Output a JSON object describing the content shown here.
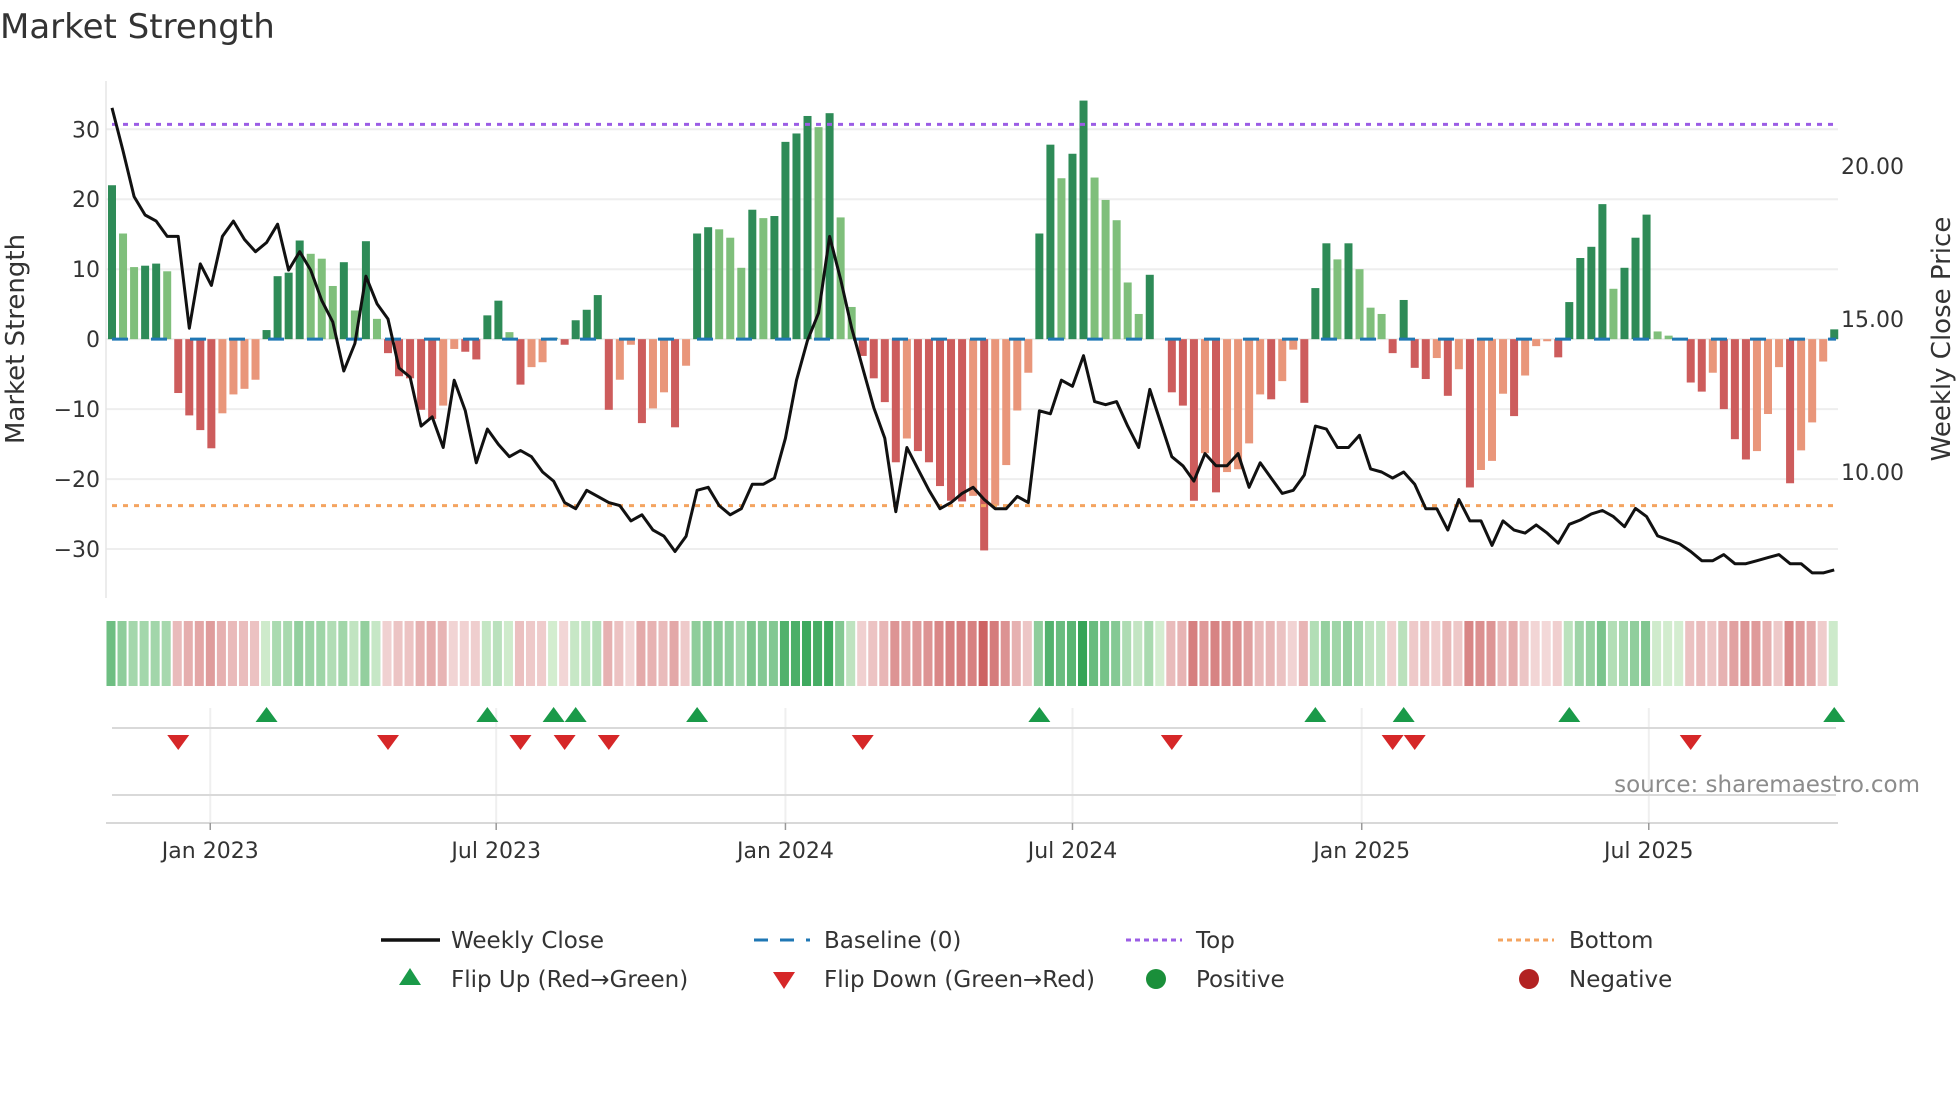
{
  "chart_data": {
    "type": "bar",
    "title": "Market Strength",
    "ylabel": "Market Strength",
    "ylabel_right": "Weekly Close Price",
    "ylim": [
      -37,
      36.9
    ],
    "ylim_right": [
      5.88,
      22.78
    ],
    "grid": true,
    "y_ticks": [
      -30,
      -20,
      -10,
      0,
      10,
      20,
      30
    ],
    "y_tick_labels": [
      "−30",
      "−20",
      "−10",
      "0",
      "10",
      "20",
      "30"
    ],
    "y_right_ticks": [
      10,
      15,
      20
    ],
    "y_right_tick_labels": [
      "10.00",
      "15.00",
      "20.00"
    ],
    "x_ticks": [
      8.9,
      34.8,
      61.0,
      87.0,
      113.2,
      139.2
    ],
    "x_tick_labels": [
      "Jan 2023",
      "Jul 2023",
      "Jan 2024",
      "Jul 2024",
      "Jan 2025",
      "Jul 2025"
    ],
    "top_level": 30.7,
    "bottom_level": -23.8,
    "baseline": 0,
    "strength": [
      22.0,
      15.1,
      10.3,
      10.5,
      10.8,
      9.7,
      -7.7,
      -10.9,
      -13.0,
      -15.6,
      -10.6,
      -7.9,
      -7.1,
      -5.8,
      1.3,
      9.0,
      9.5,
      14.1,
      12.2,
      11.5,
      7.6,
      11.0,
      4.1,
      14.0,
      2.9,
      -2.0,
      -5.3,
      -5.6,
      -10.1,
      -11.4,
      -9.5,
      -1.4,
      -1.8,
      -2.9,
      3.4,
      5.5,
      1.0,
      -6.5,
      -4.0,
      -3.3,
      0.2,
      -0.8,
      2.7,
      4.2,
      6.3,
      -10.1,
      -5.8,
      -0.8,
      -12.0,
      -9.9,
      -7.6,
      -12.6,
      -3.8,
      15.1,
      16.0,
      15.7,
      14.5,
      10.2,
      18.5,
      17.3,
      17.6,
      28.2,
      29.4,
      31.9,
      30.3,
      32.3,
      17.4,
      4.6,
      -2.4,
      -5.6,
      -9.0,
      -17.6,
      -14.2,
      -16.0,
      -17.6,
      -21.0,
      -23.1,
      -23.2,
      -22.4,
      -30.2,
      -23.8,
      -18.0,
      -10.2,
      -4.8,
      15.1,
      27.8,
      23.0,
      26.5,
      34.1,
      23.1,
      19.9,
      17.0,
      8.1,
      3.6,
      9.2,
      0,
      -7.6,
      -9.5,
      -23.1,
      -16.3,
      -21.9,
      -19.0,
      -18.6,
      -14.9,
      -7.9,
      -8.6,
      -6.0,
      -1.5,
      -9.1,
      7.3,
      13.7,
      11.4,
      13.7,
      10.0,
      4.5,
      3.6,
      -2.0,
      5.6,
      -4.1,
      -5.7,
      -2.7,
      -8.1,
      -4.3,
      -21.2,
      -18.7,
      -17.4,
      -7.8,
      -11.0,
      -5.2,
      -1.0,
      -0.3,
      -2.6,
      5.3,
      11.6,
      13.2,
      19.3,
      7.2,
      10.2,
      14.5,
      17.8,
      1.1,
      0.5,
      0,
      -6.2,
      -7.5,
      -4.8,
      -10.0,
      -14.3,
      -17.2,
      -16.0,
      -10.7,
      -4.0,
      -20.6,
      -15.9,
      -11.9,
      -3.2,
      1.4
    ],
    "strength_shade": "DLLDDLDDDDLLLLDDDDLLLDLDLDDDDDLLDDDDLDLLDDDDDDLLDLLDLDDLLLDLDDDDLDLLDDDDLDDDDDLDLLLLDDLDDLLLLLDDDDDLDLLLLDLLDDDLDLLLDDDDLDLDLLLDLLLDDDDDLDDDLLDDDLDDDLLLDLLLD",
    "weekly_close": [
      21.9,
      20.5,
      19.0,
      18.4,
      18.2,
      17.7,
      17.7,
      14.7,
      16.8,
      16.1,
      17.7,
      18.2,
      17.6,
      17.2,
      17.5,
      18.1,
      16.6,
      17.2,
      16.6,
      15.6,
      14.9,
      13.3,
      14.2,
      16.4,
      15.5,
      15.0,
      13.4,
      13.1,
      11.5,
      11.8,
      10.8,
      13.0,
      12.0,
      10.3,
      11.4,
      10.9,
      10.5,
      10.7,
      10.5,
      10.0,
      9.7,
      9.0,
      8.8,
      9.4,
      9.2,
      9.0,
      8.9,
      8.4,
      8.6,
      8.1,
      7.9,
      7.4,
      7.9,
      9.4,
      9.5,
      8.9,
      8.6,
      8.8,
      9.6,
      9.6,
      9.8,
      11.1,
      13.0,
      14.3,
      15.2,
      17.7,
      16.3,
      14.7,
      13.4,
      12.1,
      11.1,
      8.7,
      10.8,
      10.1,
      9.4,
      8.8,
      9.0,
      9.3,
      9.5,
      9.1,
      8.8,
      8.8,
      9.2,
      9.0,
      12.0,
      11.9,
      13.0,
      12.8,
      13.8,
      12.3,
      12.2,
      12.3,
      11.5,
      10.8,
      12.7,
      11.6,
      10.5,
      10.2,
      9.7,
      10.6,
      10.2,
      10.2,
      10.6,
      9.5,
      10.3,
      9.8,
      9.3,
      9.4,
      9.9,
      11.5,
      11.4,
      10.8,
      10.8,
      11.2,
      10.1,
      10.0,
      9.8,
      10.0,
      9.6,
      8.8,
      8.8,
      8.1,
      9.1,
      8.4,
      8.4,
      7.6,
      8.4,
      8.1,
      8.0,
      8.27,
      8.0,
      7.67,
      8.29,
      8.43,
      8.63,
      8.74,
      8.54,
      8.21,
      8.81,
      8.54,
      7.91,
      7.78,
      7.65,
      7.4,
      7.1,
      7.1,
      7.3,
      7.0,
      7.0,
      7.1,
      7.2,
      7.3,
      7.0,
      7.0,
      6.7,
      6.7,
      6.8
    ],
    "flip_up_weeks": [
      15,
      35,
      41,
      43,
      54,
      85,
      110,
      118,
      133,
      157
    ],
    "flip_down_weeks": [
      7,
      26,
      38,
      42,
      46,
      69,
      97,
      117,
      119,
      144
    ],
    "colors": {
      "strong_positive": "#2e8b57",
      "weak_positive": "#7fbf7b",
      "strong_negative": "#cd5c5c",
      "weak_negative": "#e9967a",
      "baseline": "#1f77b4",
      "top": "#9b5de5",
      "bottom": "#f4a460",
      "price": "#111111",
      "flip_up": "#1a9a49",
      "flip_down": "#d62728",
      "positive": "#1a8f3a",
      "negative": "#b22222"
    },
    "legend": {
      "weekly_close": "Weekly Close",
      "baseline": "Baseline (0)",
      "top": "Top",
      "bottom": "Bottom",
      "flip_up": "Flip Up (Red→Green)",
      "flip_down": "Flip Down (Green→Red)",
      "positive": "Positive",
      "negative": "Negative"
    },
    "source": "source: sharemaestro.com"
  }
}
